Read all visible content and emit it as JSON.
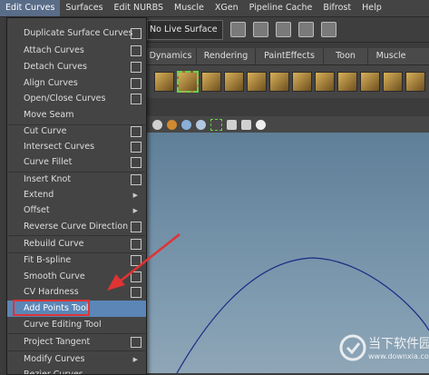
{
  "menubar": {
    "items": [
      "Edit Curves",
      "Surfaces",
      "Edit NURBS",
      "Muscle",
      "XGen",
      "Pipeline Cache",
      "Bifrost",
      "Help"
    ]
  },
  "status": {
    "live_surface": "No Live Surface"
  },
  "shelf": {
    "tabs": [
      "Dynamics",
      "Rendering",
      "PaintEffects",
      "Toon",
      "Muscle"
    ]
  },
  "menu": {
    "items": [
      {
        "label": "Duplicate Surface Curves",
        "option": true
      },
      {
        "label": "Attach Curves",
        "option": true
      },
      {
        "label": "Detach Curves",
        "option": true
      },
      {
        "label": "Align Curves",
        "option": true
      },
      {
        "label": "Open/Close Curves",
        "option": true
      },
      {
        "label": "Move Seam",
        "option": false
      },
      {
        "label": "Cut Curve",
        "option": true
      },
      {
        "label": "Intersect Curves",
        "option": true
      },
      {
        "label": "Curve Fillet",
        "option": true
      },
      {
        "label": "Insert Knot",
        "option": true
      },
      {
        "label": "Extend",
        "submenu": true
      },
      {
        "label": "Offset",
        "submenu": true
      },
      {
        "label": "Reverse Curve Direction",
        "option": true
      },
      {
        "label": "Rebuild Curve",
        "option": true
      },
      {
        "label": "Fit B-spline",
        "option": true
      },
      {
        "label": "Smooth Curve",
        "option": true
      },
      {
        "label": "CV Hardness",
        "option": true
      },
      {
        "label": "Add Points Tool",
        "option": false,
        "highlighted": true
      },
      {
        "label": "Curve Editing Tool",
        "option": false
      },
      {
        "label": "Project Tangent",
        "option": true
      },
      {
        "label": "Modify Curves",
        "submenu": true
      },
      {
        "label": "Bezier Curves",
        "submenu": true
      }
    ]
  },
  "watermark": {
    "cn": "当下软件园",
    "url": "www.downxia.com"
  },
  "colors": {
    "highlight": "#5b86b6",
    "annotation": "#e03333"
  }
}
